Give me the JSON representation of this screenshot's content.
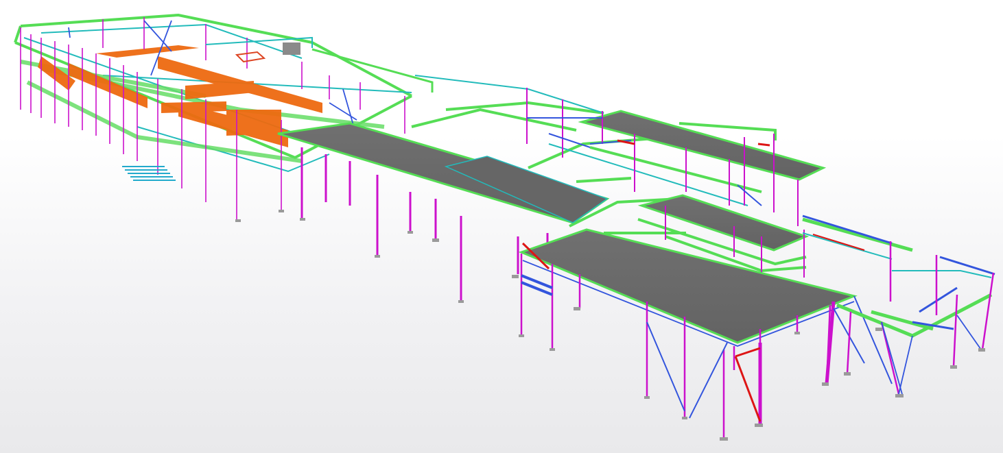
{
  "viewport": {
    "background_top": "#ffffff",
    "background_bottom": "#e8e8ea"
  },
  "colors": {
    "column": "#cc10cc",
    "beam_primary": "#55dd55",
    "beam_secondary": "#22bbbb",
    "brace": "#3355dd",
    "truss": "#ee6a10",
    "slab": "#6a6a6a",
    "highlight_brace": "#dd1515",
    "footing": "#9a9a9a"
  },
  "legend_icons": [
    "column-icon",
    "beam-icon",
    "brace-icon",
    "slab-icon",
    "truss-icon"
  ]
}
